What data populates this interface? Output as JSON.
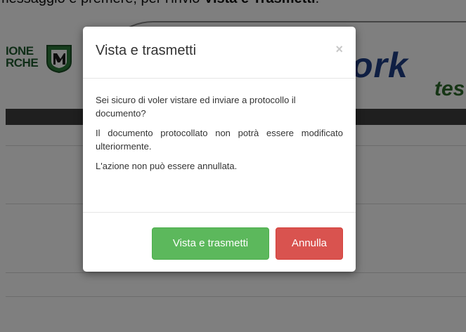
{
  "caption": {
    "prefix": "messaggio e premere, per l'invio ",
    "bold1": "Vista e Trasmetti",
    "suffix": "."
  },
  "header": {
    "logo_line1": "IONE",
    "logo_line2": "RCHE",
    "brand": "ork",
    "brand_sub": "tes"
  },
  "modal": {
    "title": "Vista e trasmetti",
    "close_label": "×",
    "body": {
      "p1": "Sei sicuro di voler vistare ed inviare a protocollo il documento?",
      "p2": "Il documento protocollato non potrà essere modificato ulteriormente.",
      "p3": "L'azione non può essere annullata."
    },
    "buttons": {
      "confirm": "Vista e trasmetti",
      "cancel": "Annulla"
    }
  },
  "colors": {
    "confirm": "#5cb85c",
    "cancel": "#d9534f",
    "navbar": "#3e3e3e"
  }
}
